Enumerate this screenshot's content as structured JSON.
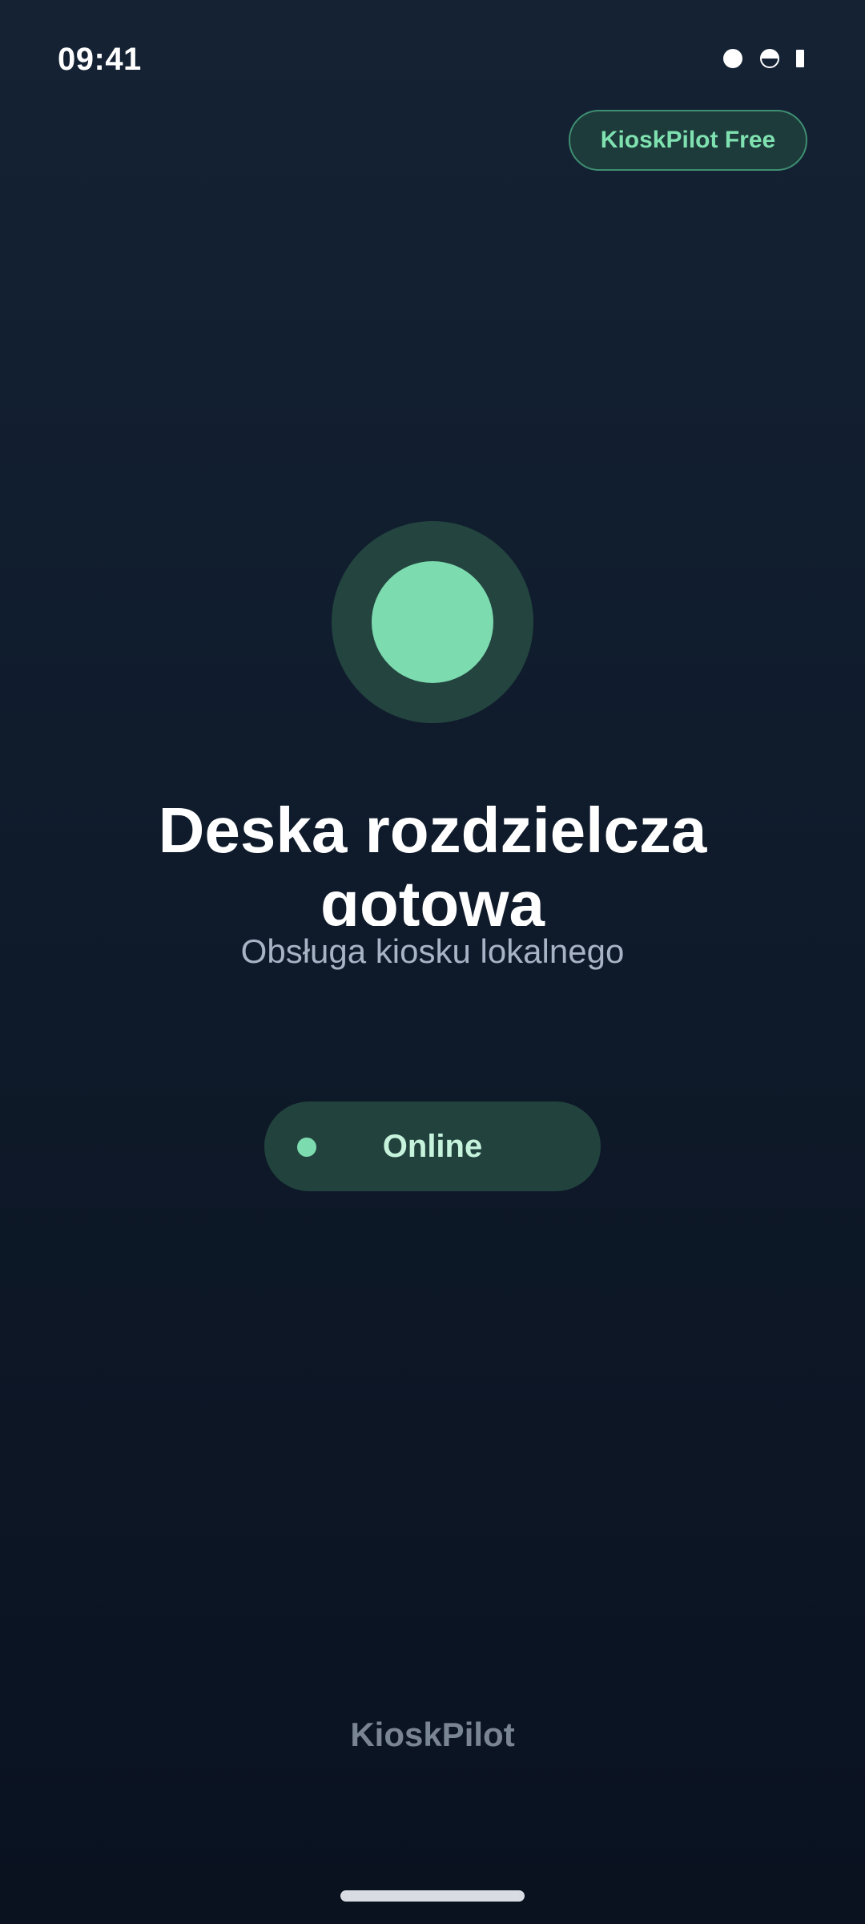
{
  "status_bar": {
    "time": "09:41",
    "icons": [
      "circle-filled-icon",
      "circle-half-icon",
      "battery-bar-icon"
    ]
  },
  "header": {
    "plan_badge": "KioskPilot Free"
  },
  "main": {
    "status_indicator_icon": "status-orb-icon",
    "title": "Deska rozdzielcza gotowa",
    "subtitle": "Obsługa kiosku lokalnego",
    "connection": {
      "label": "Online",
      "dot_icon": "status-dot-icon"
    }
  },
  "footer": {
    "brand": "KioskPilot"
  },
  "colors": {
    "accent": "#7ddbb0",
    "pill_background": "#22423d",
    "background_top": "#142234",
    "background_bottom": "#0a1220"
  }
}
